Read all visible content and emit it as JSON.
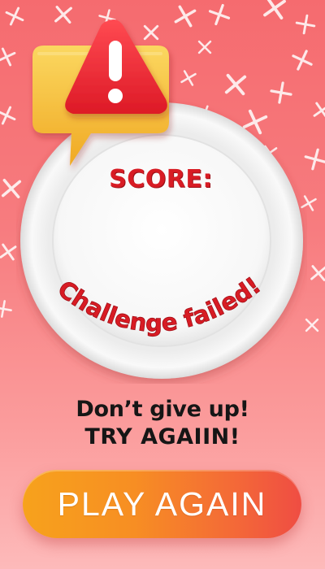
{
  "score": {
    "label": "SCORE:",
    "value": ""
  },
  "result": {
    "status_text": "Challenge failed!"
  },
  "message": {
    "line1": "Don’t give up!",
    "line2": "TRY AGAIIN!"
  },
  "actions": {
    "play_again_label": "PLAY AGAIN"
  },
  "icons": {
    "alert": "warning-icon",
    "alert_bubble": "speech-bubble-icon",
    "background": "sparkle-cross-icon"
  },
  "colors": {
    "background_top": "#f56b6f",
    "background_bottom": "#fdbaba",
    "text_red": "#d81c24",
    "text_dark": "#161616",
    "bubble_yellow": "#f7c23a",
    "triangle_red": "#f0303a",
    "button_start": "#f7a21c",
    "button_end": "#ef4d43"
  }
}
